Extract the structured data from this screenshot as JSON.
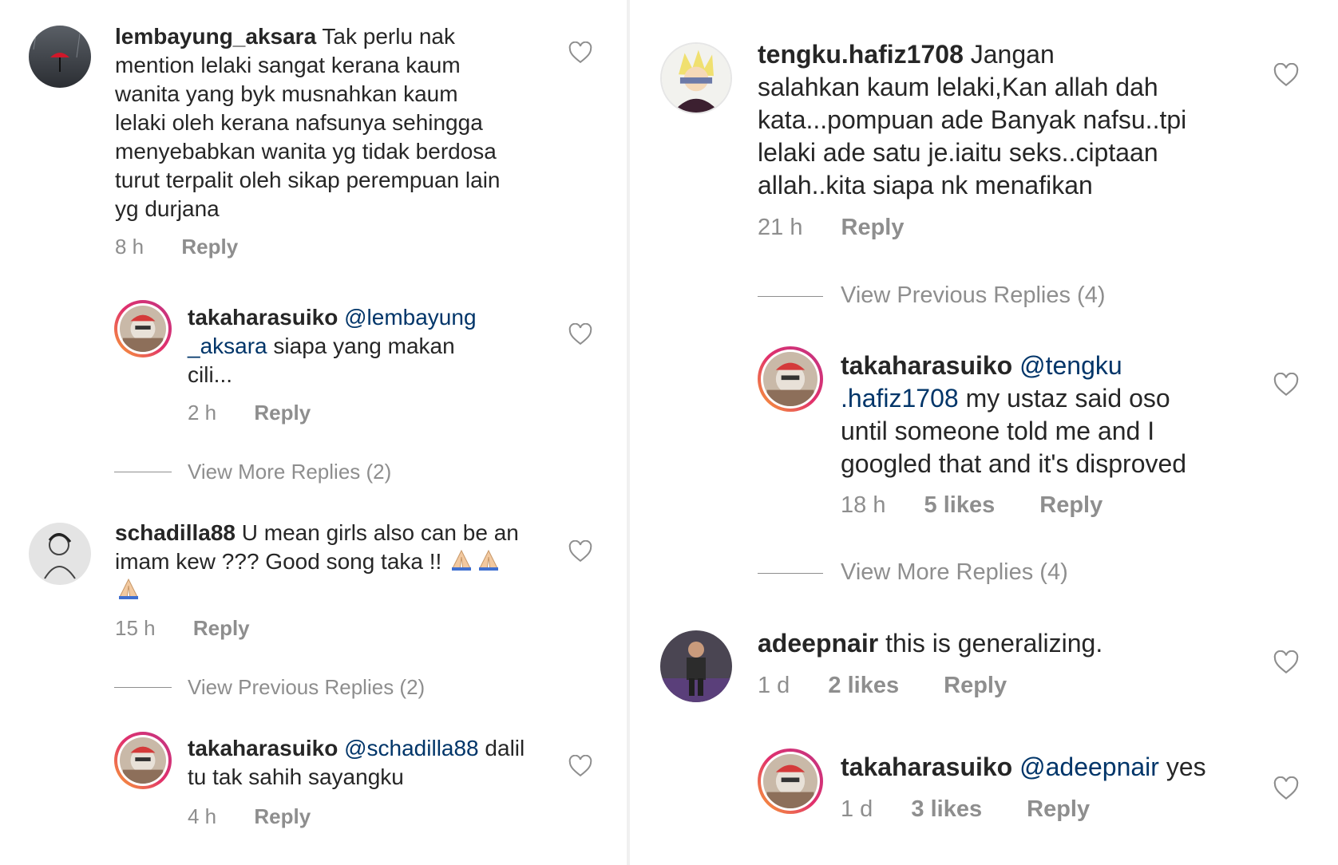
{
  "left": {
    "comment1": {
      "username": "lembayung_aksara",
      "text_lines": [
        "Tak perlu nak",
        "mention lelaki sangat kerana kaum",
        "wanita yang byk musnahkan kaum",
        "lelaki oleh kerana nafsunya sehingga",
        "menyebabkan wanita yg tidak berdosa",
        "turut terpalit oleh sikap perempuan lain",
        "yg durjana"
      ],
      "time": "8 h",
      "reply": "Reply"
    },
    "reply1": {
      "username": "takaharasuiko",
      "mention_a": "@lembayung",
      "mention_b": "_aksara",
      "text_a": " siapa yang makan",
      "text_b": "cili...",
      "time": "2 h",
      "reply": "Reply"
    },
    "view_more_1": "View More Replies (2)",
    "comment2": {
      "username": "schadilla88",
      "text_a": "U mean girls also can be an",
      "text_b": "imam kew ??? Good song taka !!",
      "time": "15 h",
      "reply": "Reply"
    },
    "view_prev_1": "View Previous Replies (2)",
    "reply2": {
      "username": "takaharasuiko",
      "mention": "@schadilla88",
      "text_a": " dalil",
      "text_b": "tu tak sahih sayangku",
      "time": "4 h",
      "reply": "Reply"
    }
  },
  "right": {
    "comment1": {
      "username": "tengku.hafiz1708",
      "text_lines": [
        "Jangan",
        "salahkan kaum lelaki,Kan allah dah",
        "kata...pompuan ade Banyak nafsu..tpi",
        "lelaki ade satu je.iaitu seks..ciptaan",
        "allah..kita siapa nk menafikan"
      ],
      "time": "21 h",
      "reply": "Reply"
    },
    "view_prev": "View Previous Replies (4)",
    "reply1": {
      "username": "takaharasuiko",
      "mention_a": "@tengku",
      "mention_b": ".hafiz1708",
      "text_lines": [
        " my ustaz said oso",
        "until someone told me and I",
        "googled that and it's disproved"
      ],
      "time": "18 h",
      "likes": "5 likes",
      "reply": "Reply"
    },
    "view_more": "View More Replies (4)",
    "comment2": {
      "username": "adeepnair",
      "text": " this is generalizing.",
      "time": "1 d",
      "likes": "2 likes",
      "reply": "Reply"
    },
    "reply2": {
      "username": "takaharasuiko",
      "mention": "@adeepnair",
      "text": " yes",
      "time": "1 d",
      "likes": "3 likes",
      "reply": "Reply"
    }
  },
  "icons": {
    "like": "heart-outline-icon",
    "emoji": "folded-hands-emoji"
  },
  "colors": {
    "text": "#262626",
    "muted": "#8e8e8e",
    "mention": "#003569",
    "story_ring_start": "#f9a534",
    "story_ring_end": "#c13584"
  }
}
